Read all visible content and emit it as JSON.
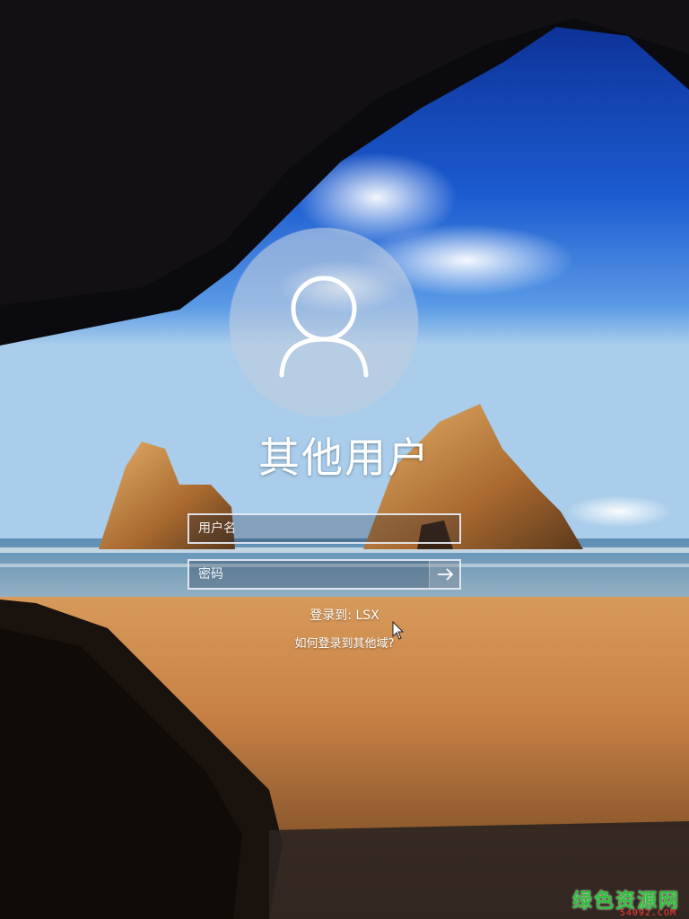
{
  "user": {
    "display_name": "其他用户",
    "avatar_icon": "user-silhouette-icon"
  },
  "login_form": {
    "username_placeholder": "用户名",
    "username_value": "",
    "password_placeholder": "密码",
    "password_value": "",
    "submit_icon": "arrow-right-icon"
  },
  "sign_in_to": "登录到: LSX",
  "other_domain_link": "如何登录到其他域?",
  "watermark": {
    "title": "绿色资源网",
    "subtitle": "54092.COM"
  },
  "colors": {
    "accent_text": "#ffffff",
    "avatar_bg": "#bfcde1",
    "watermark_green": "#2fbf3a",
    "watermark_red": "#ff3a3a"
  }
}
